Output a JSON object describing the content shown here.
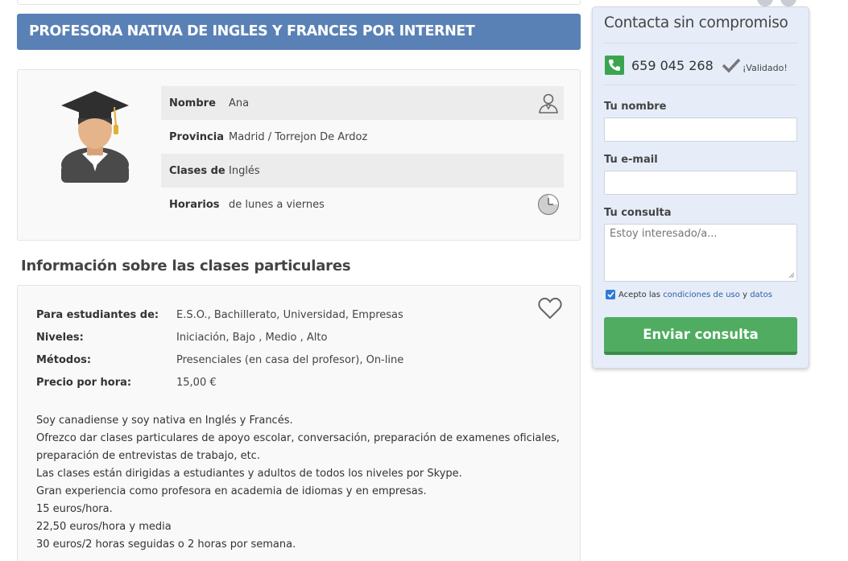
{
  "listing": {
    "title": "PROFESORA NATIVA DE INGLES Y FRANCES POR INTERNET"
  },
  "profile": {
    "rows": [
      {
        "label": "Nombre",
        "value": "Ana"
      },
      {
        "label": "Provincia",
        "value": "Madrid / Torrejon De Ardoz"
      },
      {
        "label": "Clases de",
        "value": "Inglés"
      },
      {
        "label": "Horarios",
        "value": "de lunes a viernes"
      }
    ]
  },
  "details": {
    "heading": "Información sobre las clases particulares",
    "rows": [
      {
        "label": "Para estudiantes de:",
        "value": "E.S.O., Bachillerato, Universidad, Empresas"
      },
      {
        "label": "Niveles:",
        "value": "Iniciación, Bajo , Medio , Alto"
      },
      {
        "label": "Métodos:",
        "value": "Presenciales (en casa del profesor), On-line"
      },
      {
        "label": "Precio por hora:",
        "value": "15,00 €"
      }
    ],
    "description": [
      "Soy canadiense y soy nativa en Inglés y Francés.",
      "Ofrezco dar clases particulares de apoyo escolar, conversación, preparación de examenes oficiales,",
      "preparación de entrevistas de trabajo, etc.",
      "Las clases están dirigidas a estudiantes y adultos de todos los niveles por Skype.",
      "Gran experiencia como profesora en academia de idiomas y en empresas.",
      "15 euros/hora.",
      "22,50 euros/hora y media",
      "30 euros/2 horas seguidas o 2 horas por semana."
    ]
  },
  "contact": {
    "title": "Contacta sin compromiso",
    "phone": "659 045 268",
    "validated": "¡Validado!",
    "name_label": "Tu nombre",
    "name_value": "",
    "email_label": "Tu e-mail",
    "email_value": "",
    "message_label": "Tu consulta",
    "message_placeholder": "Estoy interesado/a...",
    "accept_prefix": "Acepto las",
    "terms_link": "condiciones de uso",
    "accept_and": "y",
    "data_link": "datos",
    "send_label": "Enviar consulta"
  },
  "colors": {
    "title_bar": "#5a81b6",
    "accent_green": "#4fac60",
    "panel_bg": "#e6edf8",
    "link": "#2a5fa8"
  },
  "icons": {
    "teacher": "teacher-icon",
    "clock": "clock-icon",
    "favorite": "heart-icon",
    "phone": "phone-icon",
    "check": "checkmark-icon"
  }
}
